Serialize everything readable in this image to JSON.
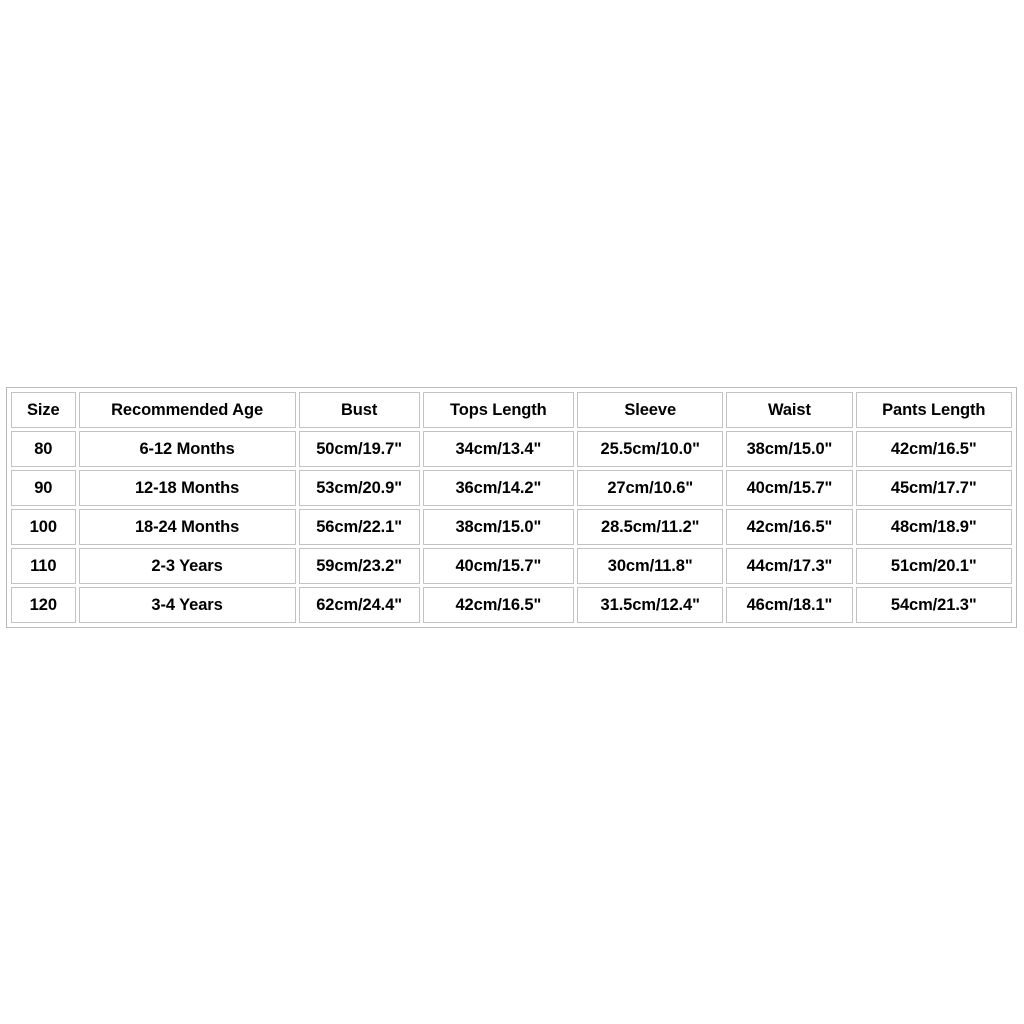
{
  "chart_data": {
    "type": "table",
    "title": "",
    "columns": [
      "Size",
      "Recommended Age",
      "Bust",
      "Tops Length",
      "Sleeve",
      "Waist",
      "Pants Length"
    ],
    "rows": [
      [
        "80",
        "6-12 Months",
        "50cm/19.7\"",
        "34cm/13.4\"",
        "25.5cm/10.0\"",
        "38cm/15.0\"",
        "42cm/16.5\""
      ],
      [
        "90",
        "12-18 Months",
        "53cm/20.9\"",
        "36cm/14.2\"",
        "27cm/10.6\"",
        "40cm/15.7\"",
        "45cm/17.7\""
      ],
      [
        "100",
        "18-24 Months",
        "56cm/22.1\"",
        "38cm/15.0\"",
        "28.5cm/11.2\"",
        "42cm/16.5\"",
        "48cm/18.9\""
      ],
      [
        "110",
        "2-3 Years",
        "59cm/23.2\"",
        "40cm/15.7\"",
        "30cm/11.8\"",
        "44cm/17.3\"",
        "51cm/20.1\""
      ],
      [
        "120",
        "3-4 Years",
        "62cm/24.4\"",
        "42cm/16.5\"",
        "31.5cm/12.4\"",
        "46cm/18.1\"",
        "54cm/21.3\""
      ]
    ]
  },
  "table": {
    "headers": {
      "size": "Size",
      "age": "Recommended Age",
      "bust": "Bust",
      "tops_length": "Tops Length",
      "sleeve": "Sleeve",
      "waist": "Waist",
      "pants_length": "Pants Length"
    },
    "rows": [
      {
        "size": "80",
        "age": "6-12 Months",
        "bust": "50cm/19.7\"",
        "tops_length": "34cm/13.4\"",
        "sleeve": "25.5cm/10.0\"",
        "waist": "38cm/15.0\"",
        "pants_length": "42cm/16.5\""
      },
      {
        "size": "90",
        "age": "12-18 Months",
        "bust": "53cm/20.9\"",
        "tops_length": "36cm/14.2\"",
        "sleeve": "27cm/10.6\"",
        "waist": "40cm/15.7\"",
        "pants_length": "45cm/17.7\""
      },
      {
        "size": "100",
        "age": "18-24 Months",
        "bust": "56cm/22.1\"",
        "tops_length": "38cm/15.0\"",
        "sleeve": "28.5cm/11.2\"",
        "waist": "42cm/16.5\"",
        "pants_length": "48cm/18.9\""
      },
      {
        "size": "110",
        "age": "2-3 Years",
        "bust": "59cm/23.2\"",
        "tops_length": "40cm/15.7\"",
        "sleeve": "30cm/11.8\"",
        "waist": "44cm/17.3\"",
        "pants_length": "51cm/20.1\""
      },
      {
        "size": "120",
        "age": "3-4 Years",
        "bust": "62cm/24.4\"",
        "tops_length": "42cm/16.5\"",
        "sleeve": "31.5cm/12.4\"",
        "waist": "46cm/18.1\"",
        "pants_length": "54cm/21.3\""
      }
    ]
  },
  "colors": {
    "background": "#ffffff",
    "cell_background": "#ffffff",
    "cell_border": "#c3c3c3",
    "table_border": "#b9b9b9",
    "text": "#000000"
  }
}
